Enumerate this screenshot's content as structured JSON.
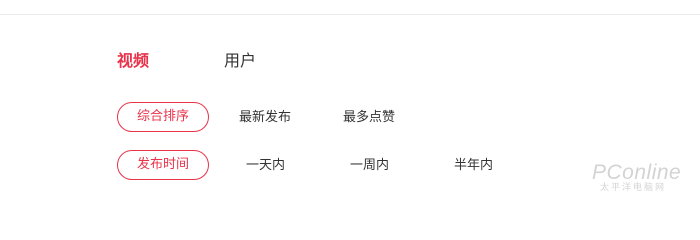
{
  "tabs": [
    {
      "label": "视频",
      "active": true
    },
    {
      "label": "用户",
      "active": false
    }
  ],
  "sort_filters": {
    "options": [
      "综合排序",
      "最新发布",
      "最多点赞"
    ],
    "selected": "综合排序"
  },
  "time_filters": {
    "options": [
      "发布时间",
      "一天内",
      "一周内",
      "半年内"
    ],
    "selected": "发布时间"
  },
  "watermark": {
    "brand": "PConline",
    "tagline": "太平洋电脑网"
  },
  "colors": {
    "accent": "#e8334a",
    "text": "#333333",
    "divider": "#ececec"
  }
}
